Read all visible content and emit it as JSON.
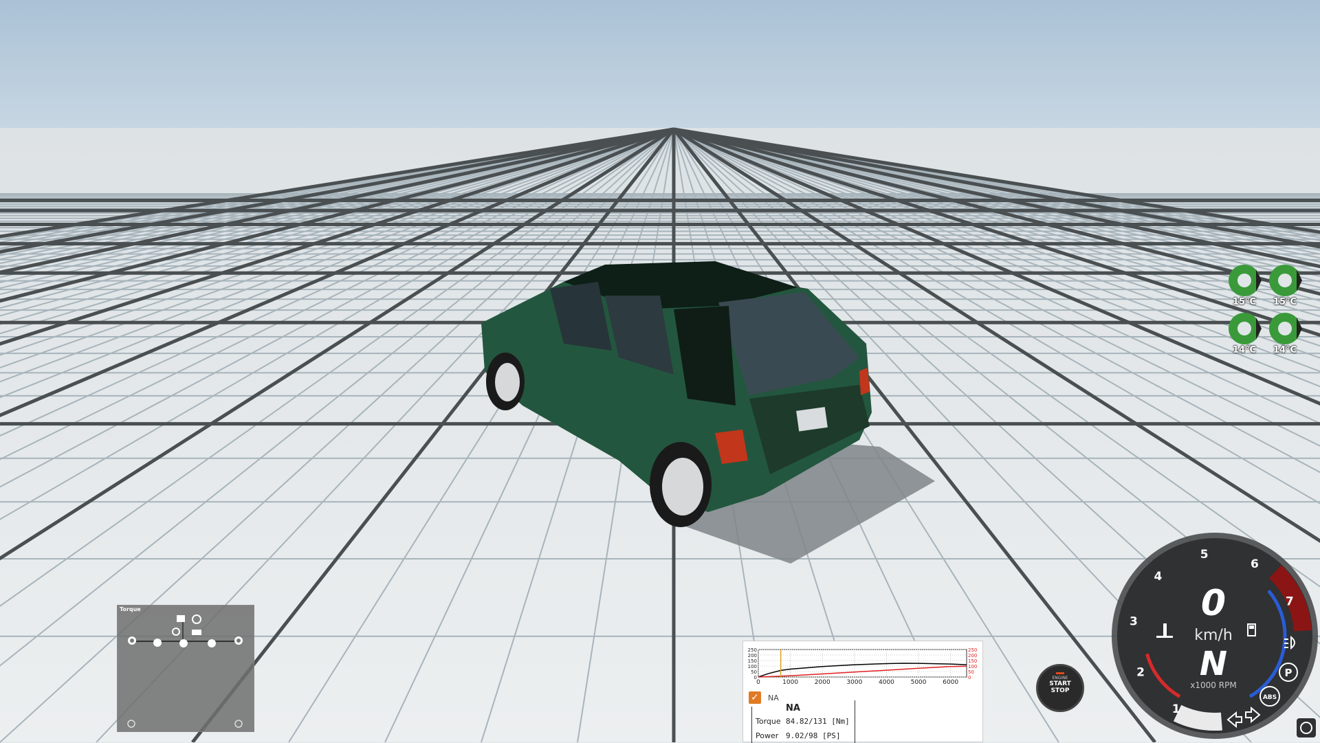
{
  "tyres": [
    {
      "position": "front-left",
      "temp": "15°C",
      "color": "#3a9a3a"
    },
    {
      "position": "front-right",
      "temp": "15°C",
      "color": "#3a9a3a"
    },
    {
      "position": "rear-left",
      "temp": "14°C",
      "color": "#3a9a3a"
    },
    {
      "position": "rear-right",
      "temp": "14°C",
      "color": "#3a9a3a"
    }
  ],
  "torque_panel": {
    "title": "Torque",
    "icons": [
      "gearbox-icon",
      "differential-icon",
      "wheel-icon",
      "shaft-icon",
      "clutch-icon",
      "engine-icon"
    ]
  },
  "engine_panel": {
    "chart_data": {
      "type": "line",
      "x_ticks": [
        "0",
        "1000",
        "2000",
        "3000",
        "4000",
        "5000",
        "6000"
      ],
      "y_left_ticks": [
        "250",
        "200",
        "150",
        "100",
        "50",
        "0"
      ],
      "y_right_ticks": [
        "250",
        "200",
        "150",
        "100",
        "50",
        "0"
      ],
      "xlim": [
        0,
        6500
      ],
      "ylim": [
        0,
        250
      ],
      "current_rpm": 700,
      "series": [
        {
          "color": "#000000",
          "x": [
            0,
            300,
            700,
            1000,
            2000,
            3000,
            4000,
            4500,
            5000,
            6000,
            6500
          ],
          "y": [
            0,
            30,
            60,
            72,
            95,
            112,
            122,
            125,
            124,
            118,
            112
          ]
        },
        {
          "color": "#e02020",
          "x": [
            0,
            700,
            1000,
            2000,
            3000,
            4000,
            5000,
            6000,
            6500
          ],
          "y": [
            0,
            8,
            12,
            28,
            45,
            62,
            80,
            95,
            98
          ]
        }
      ]
    },
    "checkbox_mark": "✓",
    "small_label": "NA",
    "title": "NA",
    "torque_label": "Torque",
    "torque_value": "84.82/131  [Nm]",
    "power_label": "Power",
    "power_value": "9.02/98    [PS]"
  },
  "engine_button": {
    "line1": "ENGINE",
    "line2": "START",
    "line3": "STOP"
  },
  "dashboard": {
    "speed": "0",
    "speed_unit": "km/h",
    "gear": "N",
    "rpm_unit": "x1000 RPM",
    "rpm_ticks": [
      "1",
      "2",
      "3",
      "4",
      "5",
      "6",
      "7"
    ],
    "rpm_value": 0.7,
    "parking_label": "P",
    "abs_label": "ABS",
    "redline_color": "#8b1515",
    "accent_blue": "#2a5cd6",
    "accent_red": "#d62a2a"
  }
}
